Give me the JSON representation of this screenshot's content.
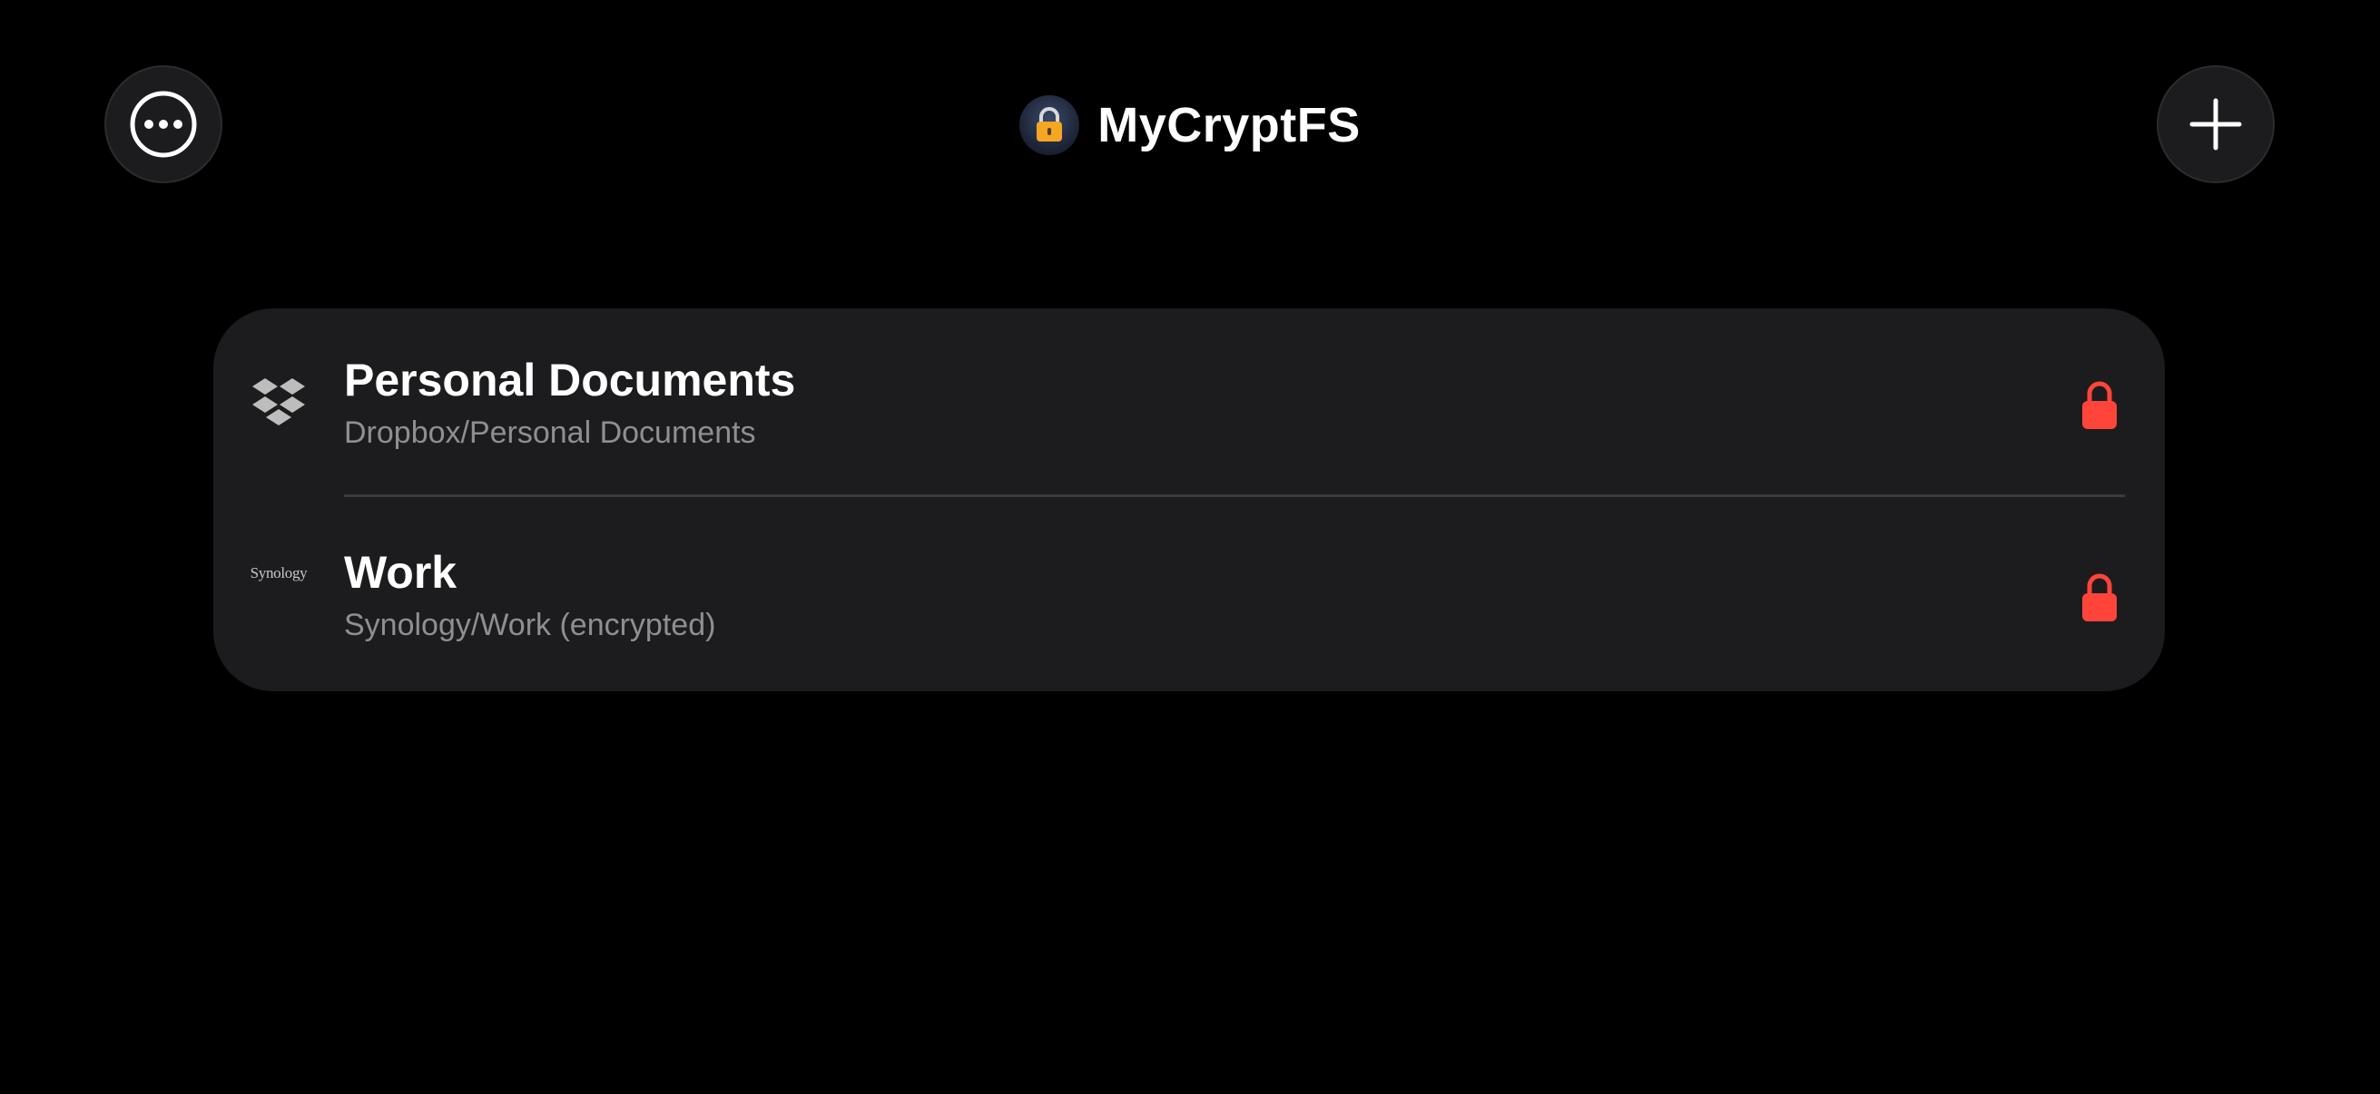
{
  "header": {
    "title": "MyCryptFS",
    "more_icon": "ellipsis-circle-icon",
    "add_icon": "plus-icon",
    "app_icon": "padlock-app-icon"
  },
  "vaults": [
    {
      "name": "Personal Documents",
      "path": "Dropbox/Personal Documents",
      "provider_icon": "dropbox-icon",
      "status_icon": "locked-icon"
    },
    {
      "name": "Work",
      "path": "Synology/Work (encrypted)",
      "provider_logo_text": "Synology",
      "provider_icon": "synology-logo",
      "status_icon": "locked-icon"
    }
  ],
  "colors": {
    "background": "#000000",
    "card": "#1c1c1e",
    "subtitle": "#8e8e93",
    "lock": "#ff453a",
    "divider": "#3a3a3c"
  }
}
